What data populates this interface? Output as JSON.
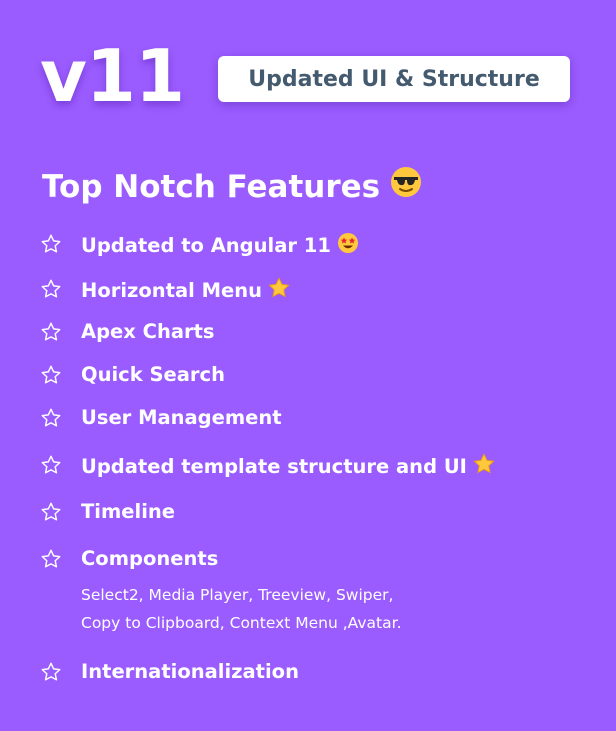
{
  "header": {
    "version": "v11",
    "badge": "Updated UI & Structure"
  },
  "section": {
    "title": "Top Notch Features",
    "title_emoji": "sunglasses-face-icon"
  },
  "features": [
    {
      "label": "Updated to Angular 11",
      "emoji": "star-struck-face-icon"
    },
    {
      "label": "Horizontal Menu",
      "emoji": "star-icon"
    },
    {
      "label": "Apex Charts"
    },
    {
      "label": "Quick Search"
    },
    {
      "label": "User Management"
    },
    {
      "label": "Updated template structure and UI",
      "emoji": "star-icon"
    },
    {
      "label": "Timeline"
    },
    {
      "label": "Components",
      "details": [
        "Select2, Media Player, Treeview, Swiper,",
        "Copy to Clipboard, Context Menu ,Avatar."
      ]
    },
    {
      "label": "Internationalization"
    }
  ],
  "colors": {
    "background": "#9b5cff",
    "badge_text": "#445a6f",
    "text": "#ffffff",
    "emoji_yellow": "#ffc83d"
  }
}
